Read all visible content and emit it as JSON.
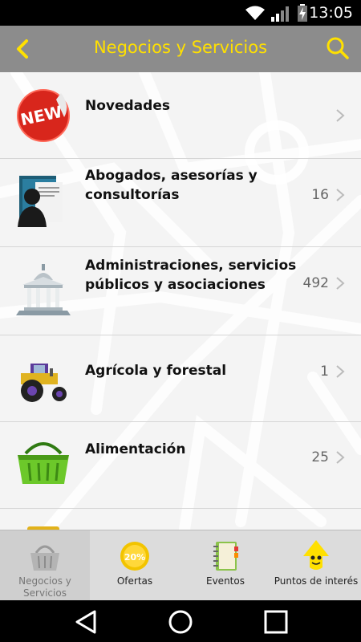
{
  "status_bar": {
    "time": "13:05",
    "icons": [
      "wifi-icon",
      "signal-icon",
      "battery-charging-icon"
    ]
  },
  "app_bar": {
    "title": "Negocios y  Servicios",
    "back_icon": "chevron-left-icon",
    "search_icon": "search-icon",
    "accent_color": "#ffe000"
  },
  "categories": [
    {
      "label": "Novedades",
      "count": "",
      "icon": "new-badge-icon"
    },
    {
      "label": "Abogados, asesorías y consultorías",
      "count": "16",
      "icon": "lawyer-icon"
    },
    {
      "label": "Administraciones, servicios públicos y asociaciones",
      "count": "492",
      "icon": "government-building-icon"
    },
    {
      "label": "Agrícola y forestal",
      "count": "1",
      "icon": "tractor-icon"
    },
    {
      "label": "Alimentación",
      "count": "25",
      "icon": "shopping-basket-icon"
    }
  ],
  "tabs": [
    {
      "label": "Negocios y Servicios",
      "icon": "basket-icon",
      "active": true
    },
    {
      "label": "Ofertas",
      "icon": "discount-badge-icon",
      "badge": "20%",
      "active": false
    },
    {
      "label": "Eventos",
      "icon": "notebook-icon",
      "active": false
    },
    {
      "label": "Puntos de interés",
      "icon": "arrow-mascot-icon",
      "active": false
    }
  ],
  "nav_bar": {
    "icons": [
      "back-triangle-icon",
      "home-circle-icon",
      "recents-square-icon"
    ]
  }
}
